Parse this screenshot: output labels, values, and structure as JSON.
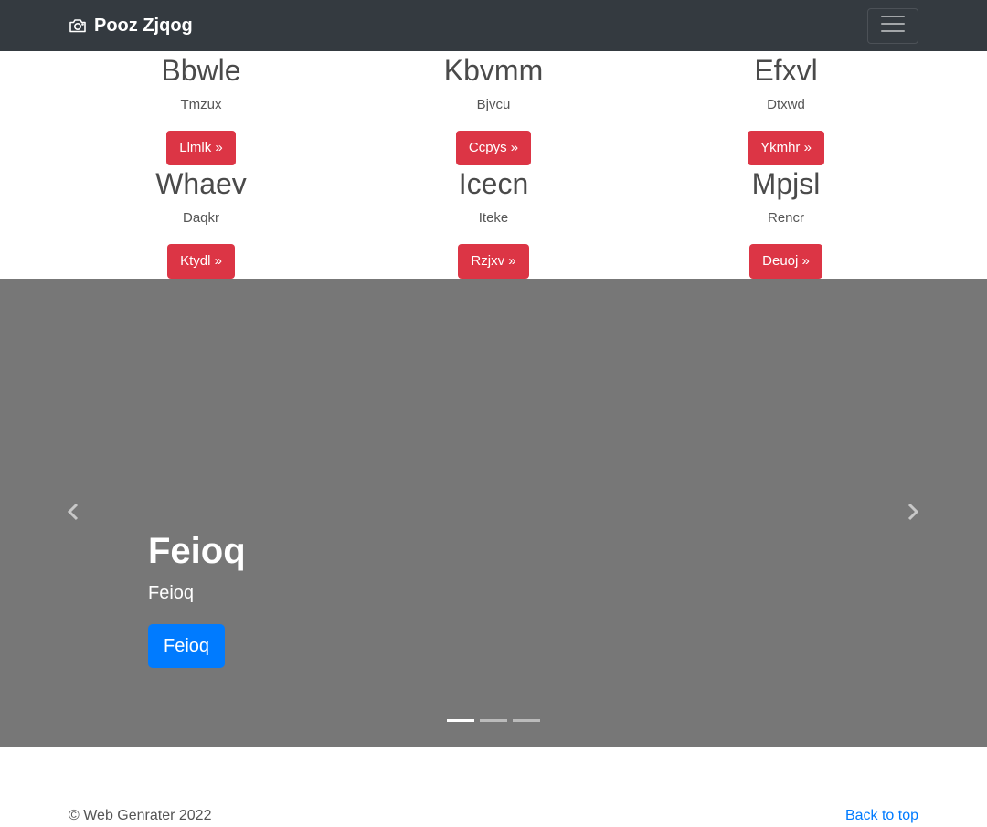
{
  "navbar": {
    "brand": "Pooz Zjqog",
    "brand_icon": "camera-icon",
    "toggler_icon": "hamburger-icon"
  },
  "features": [
    {
      "title": "Bbwle",
      "text": "Tmzux",
      "button": "Llmlk »"
    },
    {
      "title": "Kbvmm",
      "text": "Bjvcu",
      "button": "Ccpys »"
    },
    {
      "title": "Efxvl",
      "text": "Dtxwd",
      "button": "Ykmhr »"
    },
    {
      "title": "Whaev",
      "text": "Daqkr",
      "button": "Ktydl »"
    },
    {
      "title": "Icecn",
      "text": "Iteke",
      "button": "Rzjxv »"
    },
    {
      "title": "Mpjsl",
      "text": "Rencr",
      "button": "Deuoj »"
    }
  ],
  "carousel": {
    "heading": "Feioq",
    "text": "Feioq",
    "button": "Feioq",
    "prev_icon": "chevron-left-icon",
    "next_icon": "chevron-right-icon",
    "slide_count": 3,
    "active_slide": 1
  },
  "footer": {
    "copyright": "© Web Genrater 2022",
    "back_to_top": "Back to top"
  },
  "colors": {
    "navbar_bg": "#343a40",
    "feature_button": "#dc3545",
    "carousel_bg": "#777777",
    "primary": "#007bff"
  }
}
